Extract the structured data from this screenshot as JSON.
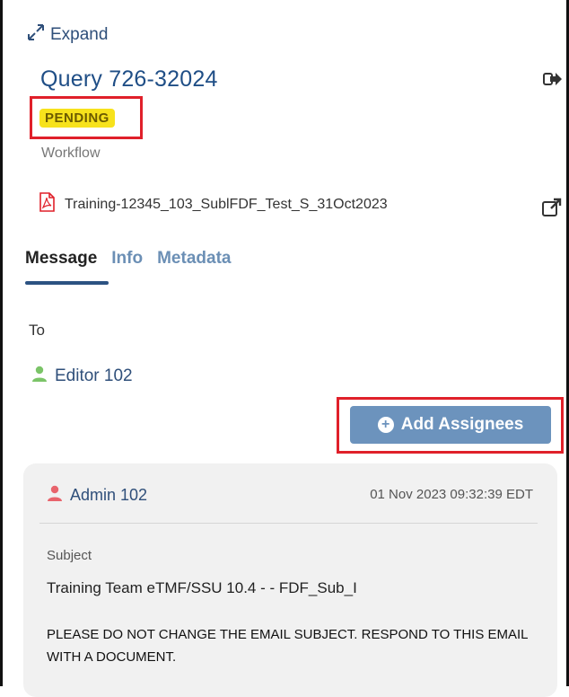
{
  "header": {
    "expand_label": "Expand",
    "title": "Query 726-32024",
    "status": "PENDING",
    "status_color": "#f7e21c",
    "sub_label": "Workflow",
    "file_name": "Training-12345_103_SublFDF_Test_S_31Oct2023"
  },
  "tabs": [
    "Message",
    "Info",
    "Metadata"
  ],
  "recipients": {
    "to_label": "To",
    "items": [
      "Editor 102"
    ]
  },
  "actions": {
    "add_assignees": "Add Assignees"
  },
  "message": {
    "from": "Admin 102",
    "timestamp": "01 Nov 2023 09:32:39 EDT",
    "subject_label": "Subject",
    "subject": "Training Team eTMF/SSU 10.4 - - FDF_Sub_I",
    "body": "PLEASE DO NOT CHANGE THE EMAIL SUBJECT. RESPOND TO THIS EMAIL WITH A DOCUMENT."
  },
  "colors": {
    "accent": "#1f4e86",
    "button": "#6c93bd",
    "highlight_border": "#e0202a",
    "user_green": "#7bc468",
    "user_red": "#e8646c"
  }
}
